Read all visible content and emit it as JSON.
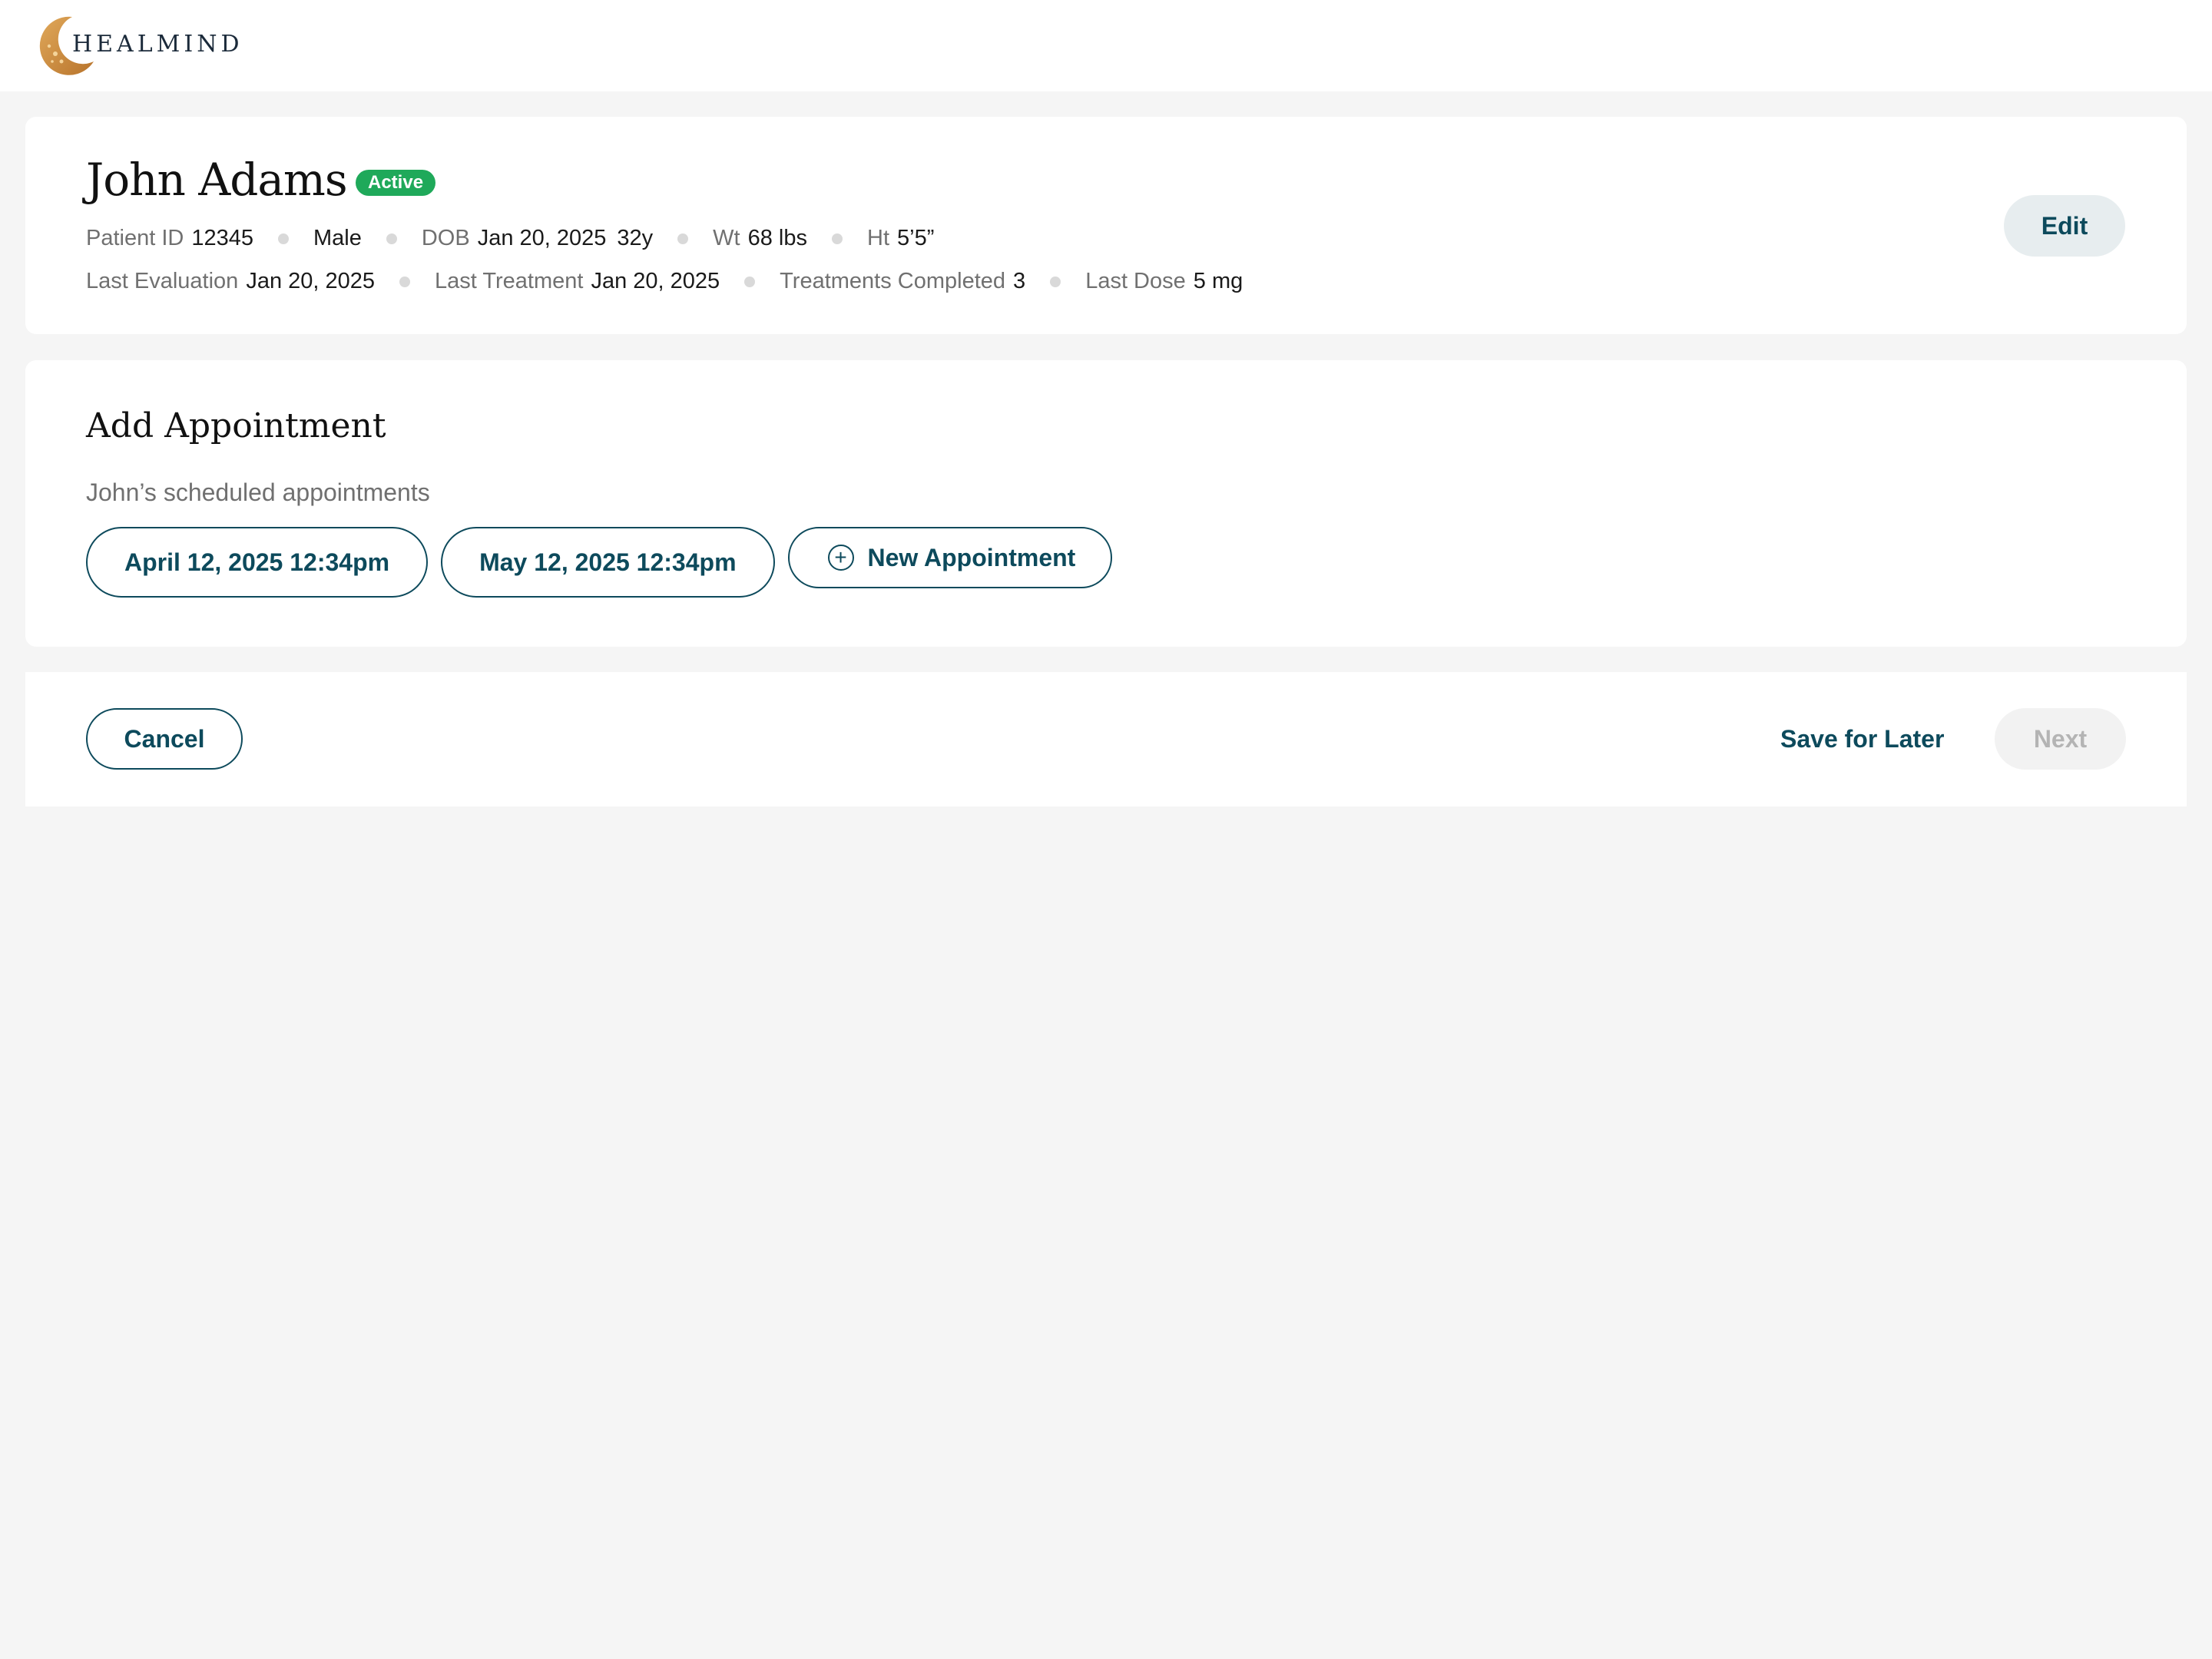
{
  "brand": {
    "name": "HEALMIND"
  },
  "patient": {
    "name": "John Adams",
    "status": "Active",
    "status_color": "#1fa95a",
    "id_label": "Patient ID",
    "id_value": "12345",
    "sex": "Male",
    "dob_label": "DOB",
    "dob_value": "Jan 20, 2025",
    "age": "32y",
    "weight_label": "Wt",
    "weight_value": "68 lbs",
    "height_label": "Ht",
    "height_value": "5’5”",
    "last_eval_label": "Last Evaluation",
    "last_eval_value": "Jan 20, 2025",
    "last_treatment_label": "Last Treatment",
    "last_treatment_value": "Jan 20, 2025",
    "treatments_completed_label": "Treatments Completed",
    "treatments_completed_value": "3",
    "last_dose_label": "Last Dose",
    "last_dose_value": "5 mg",
    "edit_label": "Edit"
  },
  "appointments": {
    "title": "Add Appointment",
    "subtitle": "John’s scheduled appointments",
    "scheduled": [
      "April 12, 2025 12:34pm",
      "May 12, 2025 12:34pm"
    ],
    "new_label": "New Appointment",
    "new_icon": "plus-circle-icon"
  },
  "footer": {
    "cancel_label": "Cancel",
    "save_label": "Save for Later",
    "next_label": "Next"
  },
  "colors": {
    "accent": "#0d4a5c",
    "background": "#f5f5f5",
    "logo_gold": "#c98a3a"
  }
}
